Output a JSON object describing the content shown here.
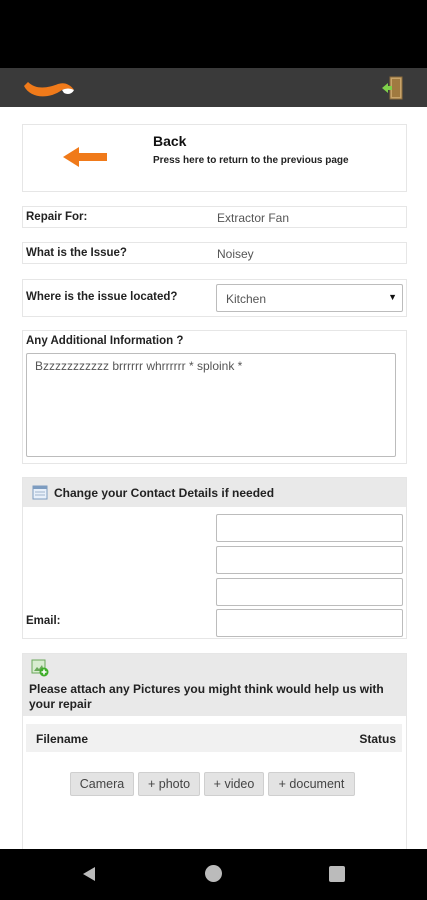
{
  "header": {
    "logo_icon": "fox-tail-logo-icon",
    "logout_icon": "exit-door-icon"
  },
  "back": {
    "title": "Back",
    "description": "Press here to return to the previous page",
    "icon": "left-arrow-icon"
  },
  "repair": {
    "repair_for_label": "Repair For:",
    "repair_for_value": "Extractor Fan",
    "issue_label": "What is the Issue?",
    "issue_value": "Noisey",
    "location_label": "Where is the issue located?",
    "location_selected": "Kitchen",
    "additional_label": "Any Additional Information ?",
    "additional_value": "Bzzzzzzzzzzz brrrrrr whrrrrrr  * sploink *"
  },
  "contact": {
    "title": "Change your Contact Details if needed",
    "email_label": "Email:",
    "icon": "calendar-card-icon"
  },
  "pictures": {
    "title": "Please attach any Pictures you might think would help us with your repair",
    "icon": "add-image-icon",
    "col_filename": "Filename",
    "col_status": "Status",
    "btn_camera": "Camera",
    "btn_photo": "+ photo",
    "btn_video": "+ video",
    "btn_document": "+ document"
  },
  "colors": {
    "accent_orange": "#f07a1a",
    "header_bg": "#3a3a3a",
    "panel_header_bg": "#e9e9e9"
  }
}
